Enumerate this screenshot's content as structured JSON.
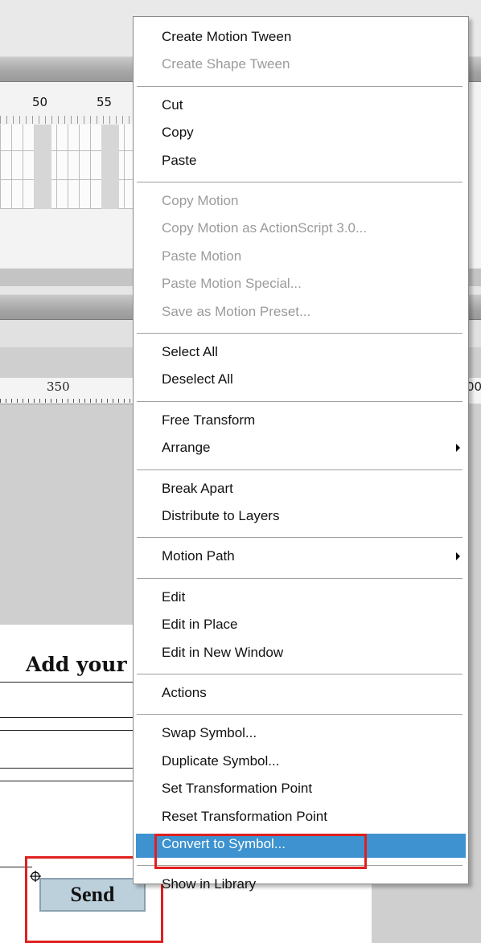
{
  "timeline": {
    "ruler_labels": [
      "50",
      "55"
    ]
  },
  "stage": {
    "ruler_label": "350",
    "ruler_label_right": "00",
    "heading": "Add your",
    "send_button": "Send"
  },
  "menu": {
    "groups": [
      {
        "items": [
          {
            "label": "Create Motion Tween",
            "enabled": true
          },
          {
            "label": "Create Shape Tween",
            "enabled": false
          }
        ]
      },
      {
        "items": [
          {
            "label": "Cut",
            "enabled": true
          },
          {
            "label": "Copy",
            "enabled": true
          },
          {
            "label": "Paste",
            "enabled": true
          }
        ]
      },
      {
        "items": [
          {
            "label": "Copy Motion",
            "enabled": false
          },
          {
            "label": "Copy Motion as ActionScript 3.0...",
            "enabled": false
          },
          {
            "label": "Paste Motion",
            "enabled": false
          },
          {
            "label": "Paste Motion Special...",
            "enabled": false
          },
          {
            "label": "Save as Motion Preset...",
            "enabled": false
          }
        ]
      },
      {
        "items": [
          {
            "label": "Select All",
            "enabled": true
          },
          {
            "label": "Deselect All",
            "enabled": true
          }
        ]
      },
      {
        "items": [
          {
            "label": "Free Transform",
            "enabled": true
          },
          {
            "label": "Arrange",
            "enabled": true,
            "submenu": true
          }
        ]
      },
      {
        "items": [
          {
            "label": "Break Apart",
            "enabled": true
          },
          {
            "label": "Distribute to Layers",
            "enabled": true
          }
        ]
      },
      {
        "items": [
          {
            "label": "Motion Path",
            "enabled": true,
            "submenu": true
          }
        ]
      },
      {
        "items": [
          {
            "label": "Edit",
            "enabled": true
          },
          {
            "label": "Edit in Place",
            "enabled": true
          },
          {
            "label": "Edit in New Window",
            "enabled": true
          }
        ]
      },
      {
        "items": [
          {
            "label": "Actions",
            "enabled": true
          }
        ]
      },
      {
        "items": [
          {
            "label": "Swap Symbol...",
            "enabled": true
          },
          {
            "label": "Duplicate Symbol...",
            "enabled": true
          },
          {
            "label": "Set Transformation Point",
            "enabled": true
          },
          {
            "label": "Reset Transformation Point",
            "enabled": true
          },
          {
            "label": "Convert to Symbol...",
            "enabled": true,
            "highlighted": true
          }
        ]
      },
      {
        "items": [
          {
            "label": "Show in Library",
            "enabled": true
          }
        ]
      }
    ]
  },
  "colors": {
    "highlight": "#3d92cf",
    "annotation_red": "#e0201e",
    "disabled_text": "#9b9b9b"
  }
}
